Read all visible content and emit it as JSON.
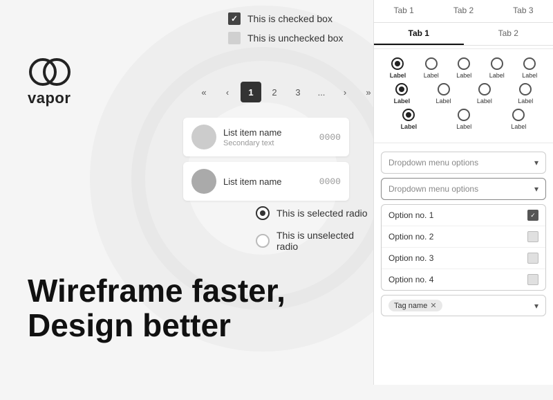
{
  "logo": {
    "text": "vapor"
  },
  "checkboxes": {
    "checked_label": "This is checked box",
    "unchecked_label": "This is unchecked box"
  },
  "pagination": {
    "prev_prev": "«",
    "prev": "‹",
    "next": "›",
    "next_next": "»",
    "pages": [
      "1",
      "2",
      "3",
      "..."
    ],
    "active_page": "1"
  },
  "list_items": [
    {
      "name": "List item name",
      "secondary": "Secondary text",
      "number": "0000"
    },
    {
      "name": "List item name",
      "secondary": "",
      "number": "0000"
    }
  ],
  "radios": {
    "selected_label": "This is selected radio",
    "unselected_label": "This is unselected radio"
  },
  "hero": {
    "line1": "Wireframe faster,",
    "line2": "Design better"
  },
  "right_panel": {
    "tabs_row1": [
      {
        "label": "Tab 1",
        "active": false
      },
      {
        "label": "Tab 2",
        "active": false
      },
      {
        "label": "Tab 3",
        "active": false
      }
    ],
    "tabs_row2": [
      {
        "label": "Tab 1",
        "active": true
      },
      {
        "label": "Tab 2",
        "active": false
      }
    ],
    "radio_grid": {
      "row1_labels": [
        "Label",
        "Label",
        "Label",
        "Label",
        "Label"
      ],
      "row2_labels": [
        "Label",
        "Label",
        "Label",
        "Label"
      ],
      "row3_labels": [
        "Label",
        "Label",
        "Label"
      ]
    },
    "dropdown1": {
      "placeholder": "Dropdown menu options"
    },
    "dropdown2": {
      "placeholder": "Dropdown menu options"
    },
    "options": [
      {
        "label": "Option no. 1",
        "checked": true
      },
      {
        "label": "Option no. 2",
        "checked": false
      },
      {
        "label": "Option no. 3",
        "checked": false
      },
      {
        "label": "Option no. 4",
        "checked": false
      }
    ],
    "tag_dropdown": {
      "tag": "Tag name",
      "placeholder": ""
    }
  }
}
